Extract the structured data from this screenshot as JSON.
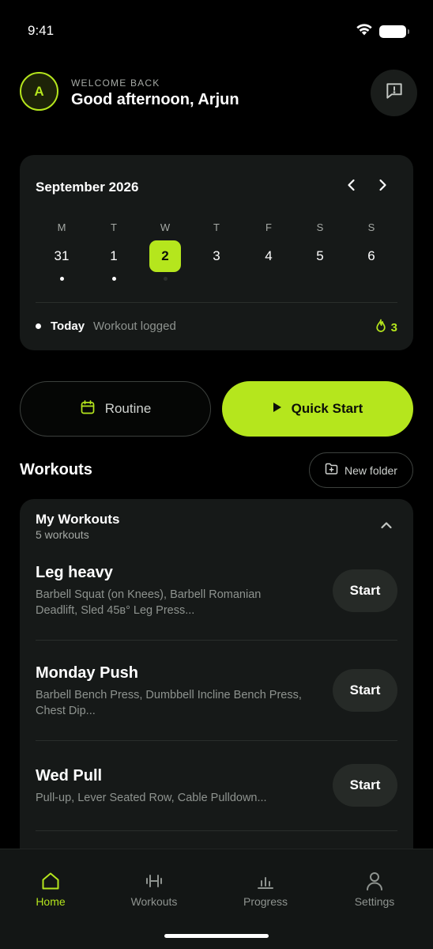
{
  "status": {
    "time": "9:41"
  },
  "header": {
    "avatar_initial": "A",
    "welcome_label": "WELCOME BACK",
    "greeting": "Good afternoon, Arjun",
    "feedback_icon": "message-alert-icon"
  },
  "calendar": {
    "month_label": "September 2026",
    "days": [
      {
        "letter": "M",
        "number": "31",
        "logged": true,
        "selected": false
      },
      {
        "letter": "T",
        "number": "1",
        "logged": true,
        "selected": false
      },
      {
        "letter": "W",
        "number": "2",
        "logged": false,
        "selected": true,
        "placeholder_dot": true
      },
      {
        "letter": "T",
        "number": "3",
        "logged": false,
        "selected": false
      },
      {
        "letter": "F",
        "number": "4",
        "logged": false,
        "selected": false
      },
      {
        "letter": "S",
        "number": "5",
        "logged": false,
        "selected": false
      },
      {
        "letter": "S",
        "number": "6",
        "logged": false,
        "selected": false
      }
    ],
    "legend_today": "Today",
    "legend_logged": "Workout logged",
    "streak_count": "3"
  },
  "actions": {
    "routine_label": "Routine",
    "quick_start_label": "Quick Start"
  },
  "workouts": {
    "title": "Workouts",
    "new_folder_label": "New folder",
    "folder": {
      "name": "My Workouts",
      "count": "5 workouts",
      "items": [
        {
          "name": "Leg heavy",
          "description": "Barbell Squat (on Knees), Barbell Romanian Deadlift, Sled 45в° Leg Press...",
          "start_label": "Start"
        },
        {
          "name": "Monday Push",
          "description": "Barbell Bench Press, Dumbbell Incline Bench Press, Chest Dip...",
          "start_label": "Start"
        },
        {
          "name": "Wed Pull",
          "description": "Pull-up, Lever Seated Row, Cable Pulldown...",
          "start_label": "Start"
        }
      ]
    }
  },
  "tabs": [
    {
      "label": "Home",
      "icon": "home-icon",
      "active": true
    },
    {
      "label": "Workouts",
      "icon": "dumbbell-icon",
      "active": false
    },
    {
      "label": "Progress",
      "icon": "bar-chart-icon",
      "active": false
    },
    {
      "label": "Settings",
      "icon": "user-icon",
      "active": false
    }
  ],
  "colors": {
    "accent": "#b5e61d",
    "card": "#161918",
    "background": "#000000"
  }
}
